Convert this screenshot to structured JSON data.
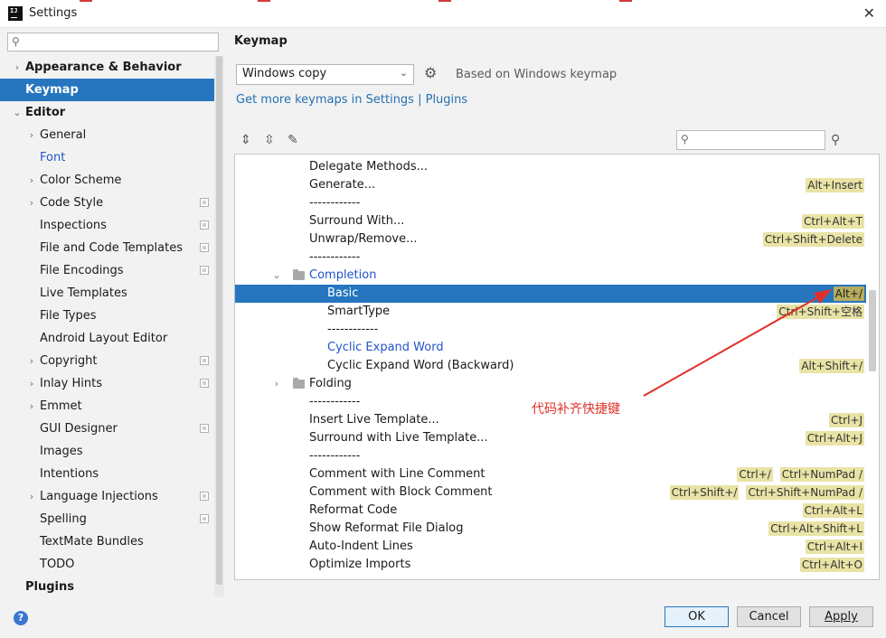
{
  "window": {
    "title": "Settings"
  },
  "sidebar": {
    "items": [
      {
        "label": "Appearance & Behavior",
        "level": 0,
        "bold": true,
        "arrow": "›"
      },
      {
        "label": "Keymap",
        "level": 0,
        "bold": true,
        "selected": true
      },
      {
        "label": "Editor",
        "level": 0,
        "bold": true,
        "arrow": "⌄"
      },
      {
        "label": "General",
        "level": 1,
        "arrow": "›"
      },
      {
        "label": "Font",
        "level": 1,
        "blue": true
      },
      {
        "label": "Color Scheme",
        "level": 1,
        "arrow": "›"
      },
      {
        "label": "Code Style",
        "level": 1,
        "arrow": "›",
        "project": true
      },
      {
        "label": "Inspections",
        "level": 1,
        "project": true
      },
      {
        "label": "File and Code Templates",
        "level": 1,
        "project": true
      },
      {
        "label": "File Encodings",
        "level": 1,
        "project": true
      },
      {
        "label": "Live Templates",
        "level": 1
      },
      {
        "label": "File Types",
        "level": 1
      },
      {
        "label": "Android Layout Editor",
        "level": 1
      },
      {
        "label": "Copyright",
        "level": 1,
        "arrow": "›",
        "project": true
      },
      {
        "label": "Inlay Hints",
        "level": 1,
        "arrow": "›",
        "project": true
      },
      {
        "label": "Emmet",
        "level": 1,
        "arrow": "›"
      },
      {
        "label": "GUI Designer",
        "level": 1,
        "project": true
      },
      {
        "label": "Images",
        "level": 1
      },
      {
        "label": "Intentions",
        "level": 1
      },
      {
        "label": "Language Injections",
        "level": 1,
        "arrow": "›",
        "project": true
      },
      {
        "label": "Spelling",
        "level": 1,
        "project": true
      },
      {
        "label": "TextMate Bundles",
        "level": 1
      },
      {
        "label": "TODO",
        "level": 1
      },
      {
        "label": "Plugins",
        "level": 0,
        "bold": true
      }
    ]
  },
  "main": {
    "title": "Keymap",
    "keymap_select": "Windows copy",
    "based_on": "Based on Windows keymap",
    "get_more_link": "Get more keymaps in Settings | Plugins",
    "search_placeholder": "",
    "actions": [
      {
        "label": "Delegate Methods...",
        "indent": 2,
        "shortcuts": []
      },
      {
        "label": "Generate...",
        "indent": 2,
        "shortcuts": [
          "Alt+Insert"
        ]
      },
      {
        "label": "------------",
        "indent": 2,
        "shortcuts": []
      },
      {
        "label": "Surround With...",
        "indent": 2,
        "shortcuts": [
          "Ctrl+Alt+T"
        ]
      },
      {
        "label": "Unwrap/Remove...",
        "indent": 2,
        "shortcuts": [
          "Ctrl+Shift+Delete"
        ]
      },
      {
        "label": "------------",
        "indent": 2,
        "shortcuts": []
      },
      {
        "label": "Completion",
        "indent": 2,
        "folder": true,
        "expanded": true,
        "blue": true,
        "shortcuts": []
      },
      {
        "label": "Basic",
        "indent": 3,
        "selected": true,
        "shortcuts": [
          "Alt+/"
        ]
      },
      {
        "label": "SmartType",
        "indent": 3,
        "shortcuts": [
          "Ctrl+Shift+空格"
        ]
      },
      {
        "label": "------------",
        "indent": 3,
        "shortcuts": []
      },
      {
        "label": "Cyclic Expand Word",
        "indent": 3,
        "blue": true,
        "shortcuts": []
      },
      {
        "label": "Cyclic Expand Word (Backward)",
        "indent": 3,
        "shortcuts": [
          "Alt+Shift+/"
        ]
      },
      {
        "label": "Folding",
        "indent": 2,
        "folder": true,
        "expanded": false,
        "shortcuts": []
      },
      {
        "label": "------------",
        "indent": 2,
        "shortcuts": []
      },
      {
        "label": "Insert Live Template...",
        "indent": 2,
        "shortcuts": [
          "Ctrl+J"
        ]
      },
      {
        "label": "Surround with Live Template...",
        "indent": 2,
        "shortcuts": [
          "Ctrl+Alt+J"
        ]
      },
      {
        "label": "------------",
        "indent": 2,
        "shortcuts": []
      },
      {
        "label": "Comment with Line Comment",
        "indent": 2,
        "shortcuts": [
          "Ctrl+/",
          "Ctrl+NumPad /"
        ]
      },
      {
        "label": "Comment with Block Comment",
        "indent": 2,
        "shortcuts": [
          "Ctrl+Shift+/",
          "Ctrl+Shift+NumPad /"
        ]
      },
      {
        "label": "Reformat Code",
        "indent": 2,
        "shortcuts": [
          "Ctrl+Alt+L"
        ]
      },
      {
        "label": "Show Reformat File Dialog",
        "indent": 2,
        "shortcuts": [
          "Ctrl+Alt+Shift+L"
        ]
      },
      {
        "label": "Auto-Indent Lines",
        "indent": 2,
        "shortcuts": [
          "Ctrl+Alt+I"
        ]
      },
      {
        "label": "Optimize Imports",
        "indent": 2,
        "shortcuts": [
          "Ctrl+Alt+O"
        ]
      }
    ]
  },
  "annotation": {
    "text": "代码补齐快捷键",
    "color": "#e0302a"
  },
  "buttons": {
    "ok": "OK",
    "cancel": "Cancel",
    "apply": "Apply"
  },
  "colors": {
    "accent": "#2675bf",
    "link": "#2470b3",
    "shortcut_bg": "#e9e3a6"
  }
}
